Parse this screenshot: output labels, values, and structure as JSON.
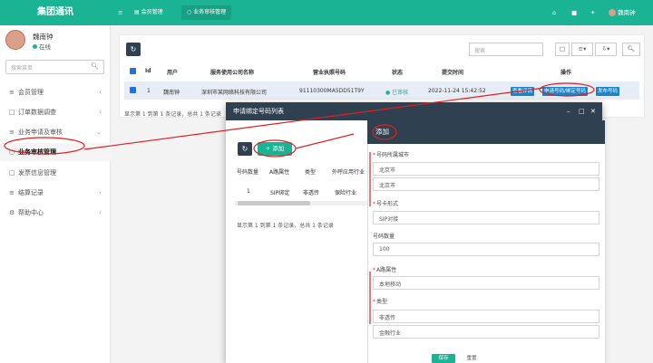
{
  "app": {
    "brand": "集团通讯"
  },
  "user": {
    "name": "魏南钟",
    "status": "在线"
  },
  "sidebar": {
    "search_placeholder": "搜索菜单",
    "items": [
      {
        "label": "会员管理",
        "icon": "menu-list-icon",
        "expanded": false
      },
      {
        "label": "订单数据调查",
        "icon": "square-icon",
        "expanded": false
      },
      {
        "label": "业务申请及审核",
        "icon": "menu-list-icon",
        "expanded": true
      },
      {
        "label": "业务审核管理",
        "icon": "circle-icon",
        "expanded": false
      },
      {
        "label": "发票信息管理",
        "icon": "square-icon",
        "expanded": false
      },
      {
        "label": "结算记录",
        "icon": "menu-list-icon",
        "expanded": false
      },
      {
        "label": "帮助中心",
        "icon": "gear-icon",
        "expanded": false
      }
    ]
  },
  "topbar": {
    "tabs": [
      {
        "label": "会员管理",
        "active": false
      },
      {
        "label": "业务审核管理",
        "active": true
      }
    ],
    "user_label": "魏南钟"
  },
  "main": {
    "search_placeholder": "搜索",
    "columns": [
      "Id",
      "用户",
      "服务使用公司名称",
      "营业执照号码",
      "状态",
      "提交时间",
      "操作"
    ],
    "row": {
      "id": "1",
      "user": "魏南钟",
      "company": "深圳市某网络科技有限公司",
      "license": "91110300MA5DD51T9Y",
      "status": "已审核",
      "submitted": "2022-11-24 15:42:52",
      "actions": [
        "查看详情",
        "申请号码/绑定号码",
        "发布号码"
      ]
    },
    "pager": "显示第 1 到第 1 条记录，总共 1 条记录"
  },
  "modal": {
    "title": "申请绑定号码列表",
    "add_label": "添加",
    "columns": [
      "号码数量",
      "A路属性",
      "类型",
      "外呼应用行业"
    ],
    "row": {
      "count": "1",
      "a_attr": "SIP绑定",
      "type": "非透传",
      "industry": "保险行业"
    },
    "pager": "显示第 1 到第 1 条记录，总共 1 条记录"
  },
  "form": {
    "title": "添加",
    "fields": [
      {
        "label": "号码所属城市",
        "required": true,
        "value": "北京市"
      },
      {
        "label": "",
        "required": false,
        "value": "北京市"
      },
      {
        "label": "号卡形式",
        "required": true,
        "value": "SIP对接"
      },
      {
        "label": "号码数量",
        "required": false,
        "value": "100"
      },
      {
        "label": "A路属性",
        "required": true,
        "value": "本地移动"
      },
      {
        "label": "类型",
        "required": true,
        "value": "非透传"
      },
      {
        "label": "",
        "required": false,
        "value": "金融行业"
      }
    ],
    "save_label": "保存",
    "reset_label": "重置"
  },
  "colors": {
    "primary": "#1ab394",
    "dark": "#2f4050",
    "annotation": "#e02020"
  }
}
